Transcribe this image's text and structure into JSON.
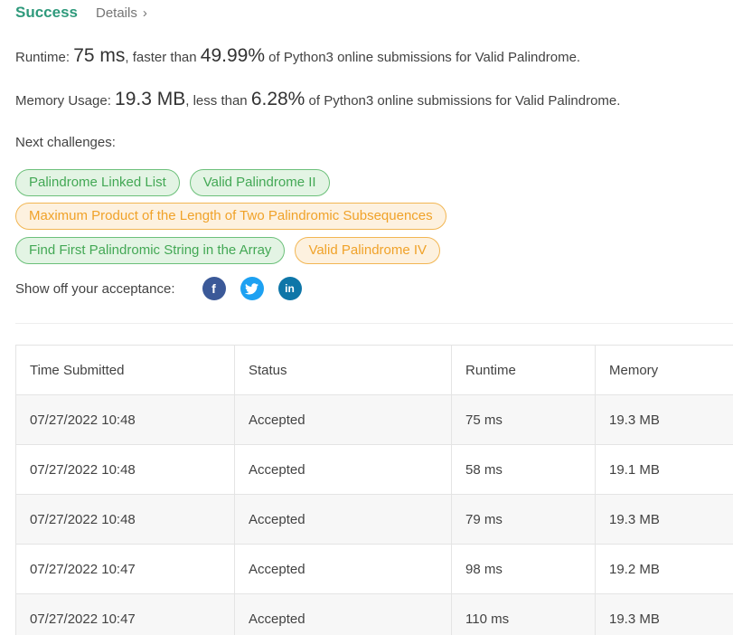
{
  "header": {
    "status": "Success",
    "details_label": "Details",
    "details_chevron": "›"
  },
  "runtime": {
    "label": "Runtime: ",
    "value": "75 ms",
    "middle": ", faster than ",
    "percent": "49.99%",
    "suffix": " of Python3 online submissions for Valid Palindrome."
  },
  "memory": {
    "label": "Memory Usage: ",
    "value": "19.3 MB",
    "middle": ", less than ",
    "percent": "6.28%",
    "suffix": " of Python3 online submissions for Valid Palindrome."
  },
  "next_challenges": {
    "label": "Next challenges:",
    "items": [
      {
        "label": "Palindrome Linked List",
        "difficulty": "easy"
      },
      {
        "label": "Valid Palindrome II",
        "difficulty": "easy"
      },
      {
        "label": "Maximum Product of the Length of Two Palindromic Subsequences",
        "difficulty": "medium"
      },
      {
        "label": "Find First Palindromic String in the Array",
        "difficulty": "easy"
      },
      {
        "label": "Valid Palindrome IV",
        "difficulty": "medium"
      }
    ]
  },
  "share": {
    "label": "Show off your acceptance:",
    "facebook_glyph": "f",
    "twitter_glyph": "🐦",
    "linkedin_glyph": "in"
  },
  "table": {
    "headers": [
      "Time Submitted",
      "Status",
      "Runtime",
      "Memory"
    ],
    "rows": [
      {
        "time": "07/27/2022 10:48",
        "status": "Accepted",
        "runtime": "75 ms",
        "memory": "19.3 MB"
      },
      {
        "time": "07/27/2022 10:48",
        "status": "Accepted",
        "runtime": "58 ms",
        "memory": "19.1 MB"
      },
      {
        "time": "07/27/2022 10:48",
        "status": "Accepted",
        "runtime": "79 ms",
        "memory": "19.3 MB"
      },
      {
        "time": "07/27/2022 10:47",
        "status": "Accepted",
        "runtime": "98 ms",
        "memory": "19.2 MB"
      },
      {
        "time": "07/27/2022 10:47",
        "status": "Accepted",
        "runtime": "110 ms",
        "memory": "19.3 MB"
      }
    ]
  },
  "colors": {
    "success_green": "#2f9a7c",
    "easy_tag_text": "#43a855",
    "medium_tag_text": "#f0a229",
    "facebook": "#3b5998",
    "twitter": "#1da1f2",
    "linkedin": "#0e76a8"
  }
}
